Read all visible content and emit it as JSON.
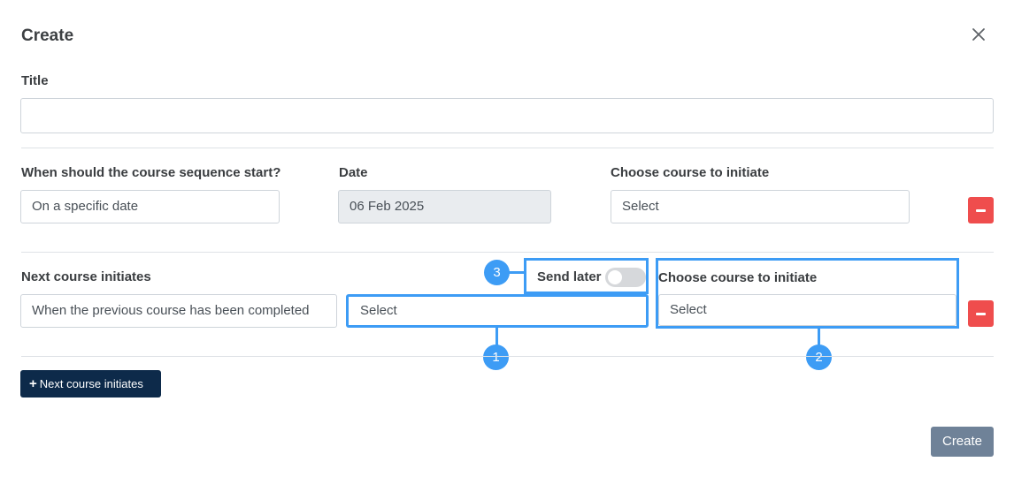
{
  "modal": {
    "title": "Create",
    "close_icon": "close-icon"
  },
  "title_field": {
    "label": "Title",
    "value": "",
    "placeholder": ""
  },
  "row1": {
    "start_label": "When should the course sequence start?",
    "start_value": "On a specific date",
    "date_label": "Date",
    "date_value": "06 Feb 2025",
    "course_label": "Choose course to initiate",
    "course_value": "Select",
    "remove_icon": "minus-icon"
  },
  "row2": {
    "next_label": "Next course initiates",
    "next_value": "When the previous course has been completed",
    "delay_value": "Select",
    "send_later_label": "Send later",
    "send_later_on": false,
    "course_label": "Choose course to initiate",
    "course_value": "Select",
    "remove_icon": "minus-icon"
  },
  "annotations": {
    "badge1": "1",
    "badge2": "2",
    "badge3": "3",
    "color": "#3d9cf5"
  },
  "actions": {
    "add_next_label": "Next course initiates",
    "create_label": "Create"
  }
}
